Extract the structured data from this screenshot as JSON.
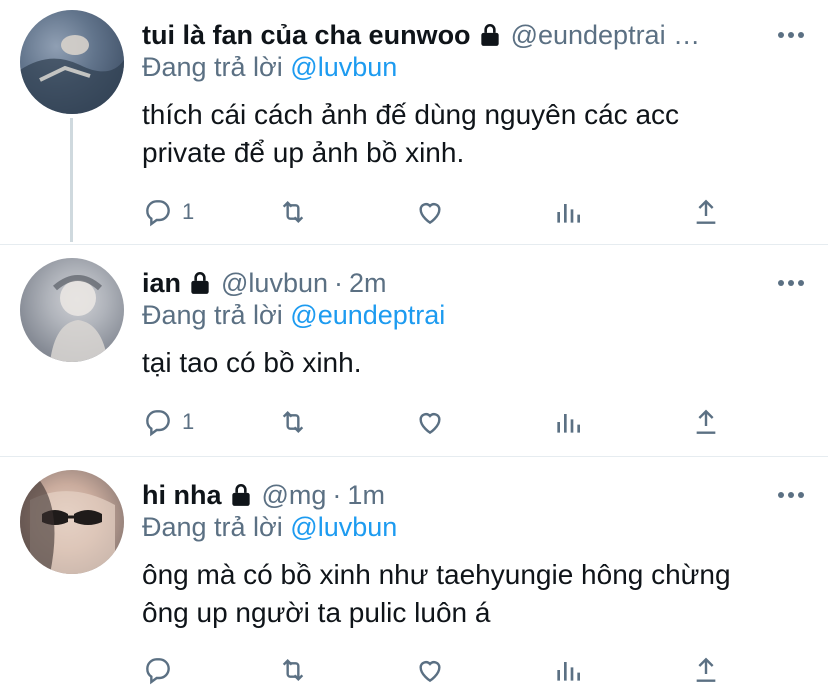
{
  "tweets": [
    {
      "name": "tui là fan của cha eunwoo",
      "handle": "@eundeptrai …",
      "time": "",
      "replying_label": "Đang trả lời",
      "replying_to": "@luvbun",
      "text_lines": [
        "thích cái cách ảnh đế dùng nguyên các acc",
        "private để up ảnh bồ xinh."
      ],
      "reply_count": "1",
      "retweet_count": "",
      "like_count": ""
    },
    {
      "name": "ian",
      "handle": "@luvbun",
      "time": "2m",
      "replying_label": "Đang trả lời",
      "replying_to": "@eundeptrai",
      "text_lines": [
        "tại tao có bồ xinh."
      ],
      "reply_count": "1",
      "retweet_count": "",
      "like_count": ""
    },
    {
      "name": "hi nha",
      "handle": "@mg",
      "time": "1m",
      "replying_label": "Đang trả lời",
      "replying_to": "@luvbun",
      "text_lines": [
        "ông mà có bồ xinh như taehyungie hông chừng",
        "ông up người ta pulic luôn á"
      ],
      "reply_count": "",
      "retweet_count": "",
      "like_count": ""
    }
  ],
  "icons": {
    "lock": "lock-icon",
    "more": "more-icon",
    "reply": "reply-icon",
    "retweet": "retweet-icon",
    "like": "like-icon",
    "analytics": "analytics-icon",
    "share": "share-icon"
  },
  "colors": {
    "text": "#0f1419",
    "secondary": "#5b7083",
    "link": "#1d9bf0",
    "thread_line": "#cfd9de"
  }
}
